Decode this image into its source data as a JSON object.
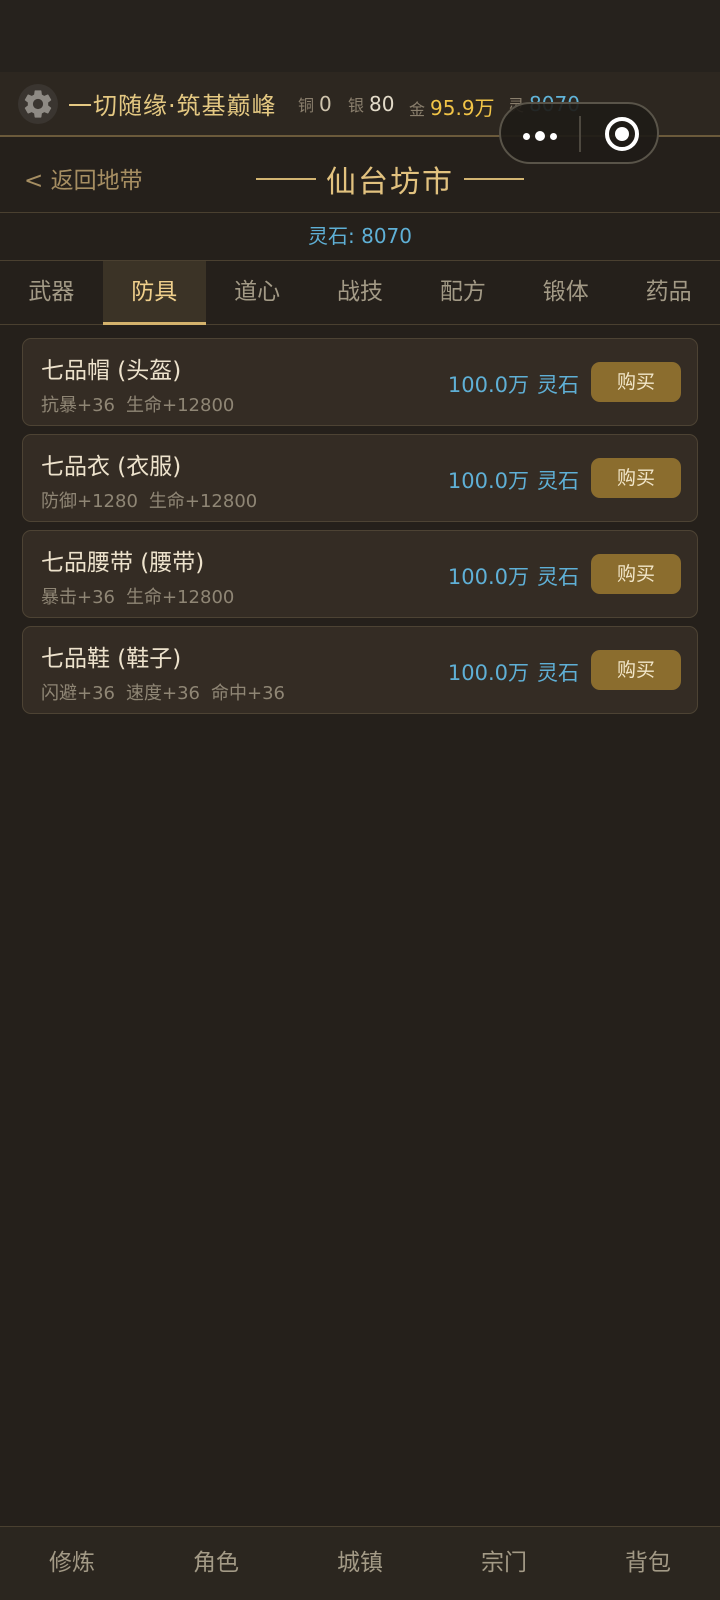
{
  "player": {
    "name": "一切随缘·筑基巅峰",
    "currency": {
      "copper": {
        "label": "铜",
        "value": "0"
      },
      "silver": {
        "label": "银",
        "value": "80"
      },
      "gold": {
        "label": "金",
        "value": "95.9万"
      },
      "spirit": {
        "label": "灵",
        "value": "8070"
      }
    }
  },
  "header": {
    "back_label": "< 返回地带",
    "title": "仙台坊市"
  },
  "balance": "灵石: 8070",
  "tabs": [
    {
      "label": "武器"
    },
    {
      "label": "防具"
    },
    {
      "label": "道心"
    },
    {
      "label": "战技"
    },
    {
      "label": "配方"
    },
    {
      "label": "锻体"
    },
    {
      "label": "药品"
    }
  ],
  "active_tab": "防具",
  "items": [
    {
      "name": "七品帽 (头盔)",
      "stats": [
        "抗暴+36",
        "生命+12800"
      ],
      "price": "100.0万",
      "unit": "灵石",
      "buy_label": "购买"
    },
    {
      "name": "七品衣 (衣服)",
      "stats": [
        "防御+1280",
        "生命+12800"
      ],
      "price": "100.0万",
      "unit": "灵石",
      "buy_label": "购买"
    },
    {
      "name": "七品腰带 (腰带)",
      "stats": [
        "暴击+36",
        "生命+12800"
      ],
      "price": "100.0万",
      "unit": "灵石",
      "buy_label": "购买"
    },
    {
      "name": "七品鞋 (鞋子)",
      "stats": [
        "闪避+36",
        "速度+36",
        "命中+36"
      ],
      "price": "100.0万",
      "unit": "灵石",
      "buy_label": "购买"
    }
  ],
  "bottom_nav": [
    {
      "label": "修炼"
    },
    {
      "label": "角色"
    },
    {
      "label": "城镇"
    },
    {
      "label": "宗门"
    },
    {
      "label": "背包"
    }
  ],
  "icons": {
    "settings": "gear-icon",
    "capsule_menu": "more-dots-icon",
    "capsule_close": "target-circle-icon"
  },
  "colors": {
    "background": "#25201b",
    "accent_gold": "#e2c27f",
    "spirit_blue": "#5fb0d6",
    "gold_value": "#f1c447",
    "buy_button": "#8b6d2e"
  }
}
